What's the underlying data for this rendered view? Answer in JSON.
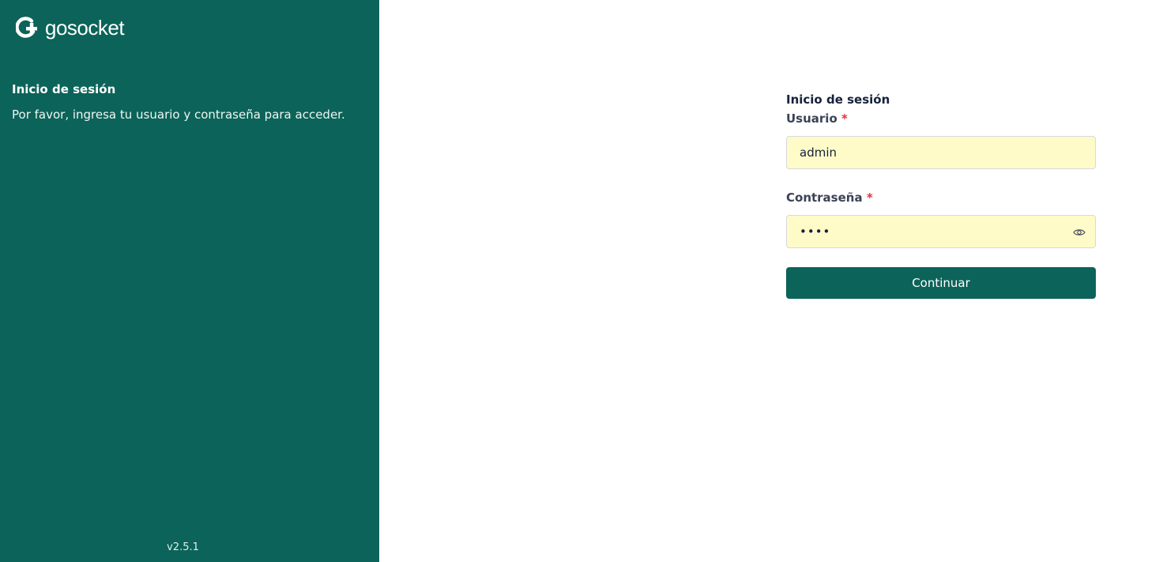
{
  "brand": {
    "logo_text": "gosocket",
    "panel_color": "#0c6359"
  },
  "left": {
    "title": "Inicio de sesión",
    "description": "Por favor, ingresa tu usuario y contraseña para acceder.",
    "version": "v2.5.1"
  },
  "form": {
    "title": "Inicio de sesión",
    "username": {
      "label": "Usuario",
      "required_mark": "*",
      "value": "admin"
    },
    "password": {
      "label": "Contraseña",
      "required_mark": "*",
      "masked_value": "••••",
      "toggle_icon": "eye-icon"
    },
    "submit_label": "Continuar"
  }
}
